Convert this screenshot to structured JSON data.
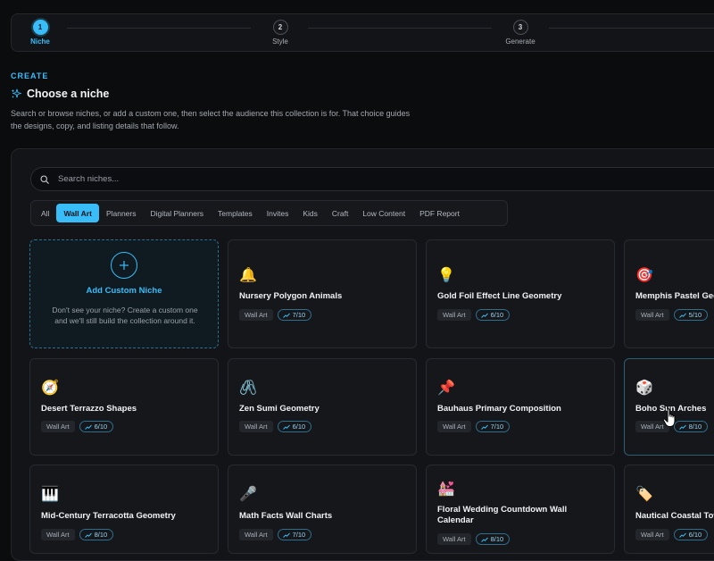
{
  "stepper": {
    "steps": [
      {
        "number": "1",
        "label": "Niche"
      },
      {
        "number": "2",
        "label": "Style"
      },
      {
        "number": "3",
        "label": "Generate"
      }
    ]
  },
  "header": {
    "eyebrow": "CREATE",
    "title": "Choose a niche",
    "description": "Search or browse niches, or add a custom one, then select the audience this collection is for. That choice guides the designs, copy, and listing details that follow."
  },
  "search": {
    "placeholder": "Search niches..."
  },
  "tabs": [
    "All",
    "Wall Art",
    "Planners",
    "Digital Planners",
    "Templates",
    "Invites",
    "Kids",
    "Craft",
    "Low Content",
    "PDF Report"
  ],
  "active_tab": "Wall Art",
  "add_card": {
    "title": "Add Custom Niche",
    "description": "Don't see your niche? Create a custom one and we'll still build the collection around it."
  },
  "cards": [
    {
      "icon": "bell-icon",
      "emoji": "🔔",
      "title": "Nursery Polygon Animals",
      "category": "Wall Art",
      "score": "7/10"
    },
    {
      "icon": "lightbulb-icon",
      "emoji": "💡",
      "title": "Gold Foil Effect Line Geometry",
      "category": "Wall Art",
      "score": "6/10"
    },
    {
      "icon": "target-icon",
      "emoji": "🎯",
      "title": "Memphis Pastel Geometric",
      "category": "Wall Art",
      "score": "5/10"
    },
    {
      "icon": "compass-icon",
      "emoji": "🧭",
      "title": "Desert Terrazzo Shapes",
      "category": "Wall Art",
      "score": "6/10"
    },
    {
      "icon": "paperclip-icon",
      "emoji": "🖇️",
      "title": "Zen Sumi Geometry",
      "category": "Wall Art",
      "score": "6/10"
    },
    {
      "icon": "pushpin-icon",
      "emoji": "📌",
      "title": "Bauhaus Primary Composition",
      "category": "Wall Art",
      "score": "7/10"
    },
    {
      "icon": "dice-icon",
      "emoji": "🎲",
      "title": "Boho Sun Arches",
      "category": "Wall Art",
      "score": "8/10"
    },
    {
      "icon": "piano-icon",
      "emoji": "🎹",
      "title": "Mid-Century Terracotta Geometry",
      "category": "Wall Art",
      "score": "8/10"
    },
    {
      "icon": "microphone-icon",
      "emoji": "🎤",
      "title": "Math Facts Wall Charts",
      "category": "Wall Art",
      "score": "7/10"
    },
    {
      "icon": "wedding-icon",
      "emoji": "💒",
      "title": "Floral Wedding Countdown Wall Calendar",
      "category": "Wall Art",
      "score": "8/10"
    },
    {
      "icon": "tag-icon",
      "emoji": "🏷️",
      "title": "Nautical Coastal Town",
      "category": "Wall Art",
      "score": "6/10"
    }
  ],
  "colors": {
    "accent": "#38bdf8",
    "background": "#0b0c0e",
    "card": "#15171b"
  }
}
